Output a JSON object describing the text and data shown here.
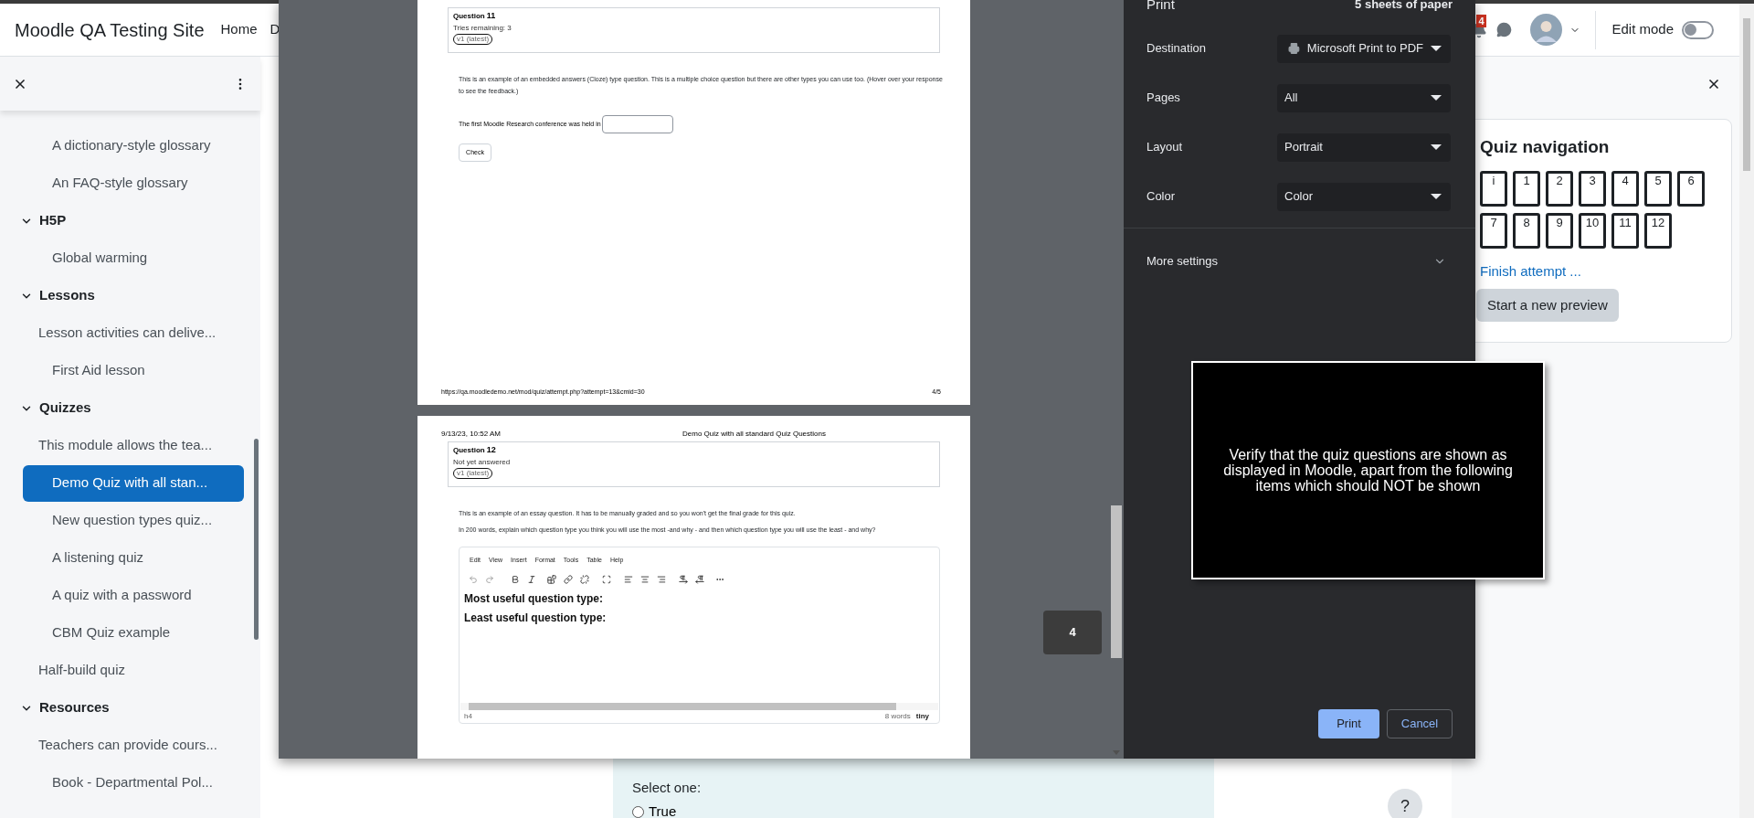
{
  "header": {
    "site_name": "Moodle QA Testing Site",
    "nav": [
      {
        "label": "Home"
      },
      {
        "label": "D"
      }
    ],
    "notification_count": "4",
    "edit_mode": {
      "label": "Edit mode",
      "on": false
    }
  },
  "sidebar": {
    "items": [
      {
        "kind": "activity",
        "label": "A dictionary-style glossary",
        "selected": false
      },
      {
        "kind": "activity",
        "label": "An FAQ-style glossary",
        "selected": false
      },
      {
        "kind": "section",
        "label": "H5P",
        "expanded": true,
        "children": [
          {
            "kind": "activity",
            "label": "Global warming",
            "selected": false
          }
        ]
      },
      {
        "kind": "section",
        "label": "Lessons",
        "expanded": true,
        "children": [
          {
            "kind": "label",
            "label": "Lesson activities can delive..."
          },
          {
            "kind": "activity",
            "label": "First Aid lesson",
            "selected": false
          }
        ]
      },
      {
        "kind": "section",
        "label": "Quizzes",
        "expanded": true,
        "children": [
          {
            "kind": "label",
            "label": "This module allows the tea..."
          },
          {
            "kind": "activity",
            "label": "Demo Quiz with all stan...",
            "selected": true
          },
          {
            "kind": "activity",
            "label": "New question types quiz...",
            "selected": false
          },
          {
            "kind": "activity",
            "label": "A listening quiz",
            "selected": false
          },
          {
            "kind": "activity",
            "label": "A quiz with a password",
            "selected": false
          },
          {
            "kind": "activity",
            "label": "CBM Quiz example",
            "selected": false
          },
          {
            "kind": "label",
            "label": "Half-build quiz"
          }
        ]
      },
      {
        "kind": "section",
        "label": "Resources",
        "expanded": true,
        "children": [
          {
            "kind": "label",
            "label": "Teachers can provide cours..."
          },
          {
            "kind": "activity",
            "label": "Book - Departmental Pol...",
            "selected": false
          }
        ]
      }
    ]
  },
  "print_preview": {
    "pages": [
      {
        "question": {
          "label": "Question",
          "number": "11",
          "status": "Tries remaining: 3",
          "version": "v1 (latest)"
        },
        "paragraphs": [
          "This is an example of an embedded answers (Cloze) type question. This is a multiple choice question but there are other types you can use too. (Hover over your response to see the feedback.)"
        ],
        "cloze": {
          "text": "The first Moodle Research conference was held in",
          "button": "Check"
        },
        "footer": {
          "url": "https://qa.moodledemo.net/mod/quiz/attempt.php?attempt=13&cmid=30",
          "page": "4/5"
        }
      },
      {
        "page_header": {
          "date": "9/13/23, 10:52 AM",
          "title": "Demo Quiz with all standard Quiz Questions"
        },
        "question": {
          "label": "Question",
          "number": "12",
          "status": "Not yet answered",
          "version": "v1 (latest)"
        },
        "paragraphs": [
          "This is an example of an essay question. It has to be manually graded and so you won't get the final grade for this quiz.",
          "In 200 words, explain which question type you think you will use the most  -and why - and then which question type you will use the least - and why?"
        ],
        "editor": {
          "menu": [
            "Edit",
            "View",
            "Insert",
            "Format",
            "Tools",
            "Table",
            "Help"
          ],
          "content": [
            "Most useful question type:",
            "Least useful question type:"
          ],
          "path": "h4",
          "word_count": "8 words",
          "brand": "tiny"
        }
      }
    ],
    "page_indicator": "4"
  },
  "print_settings": {
    "title": "Print",
    "sheets": "5 sheets of paper",
    "rows": [
      {
        "label": "Destination",
        "value": "Microsoft Print to PDF",
        "kind": "printer"
      },
      {
        "label": "Pages",
        "value": "All",
        "kind": "select"
      },
      {
        "label": "Layout",
        "value": "Portrait",
        "kind": "select"
      },
      {
        "label": "Color",
        "value": "Color",
        "kind": "select"
      }
    ],
    "more_settings": {
      "label": "More settings",
      "expanded": false
    },
    "buttons": [
      {
        "label": "Print",
        "kind": "primary"
      },
      {
        "label": "Cancel",
        "kind": "secondary"
      }
    ]
  },
  "overlay_note": {
    "text": "Verify that the quiz questions are shown as displayed in Moodle, apart from the following items which should NOT be shown"
  },
  "quiz_navigation": {
    "title": "Quiz navigation",
    "buttons": [
      "i",
      "1",
      "2",
      "3",
      "4",
      "5",
      "6",
      "7",
      "8",
      "9",
      "10",
      "11",
      "12"
    ],
    "finish_link": "Finish attempt ...",
    "new_preview_button": "Start a new preview"
  },
  "question_panel": {
    "prompt": "Select one:",
    "options": [
      {
        "label": "True",
        "selected": false
      }
    ]
  },
  "help_button": "?"
}
